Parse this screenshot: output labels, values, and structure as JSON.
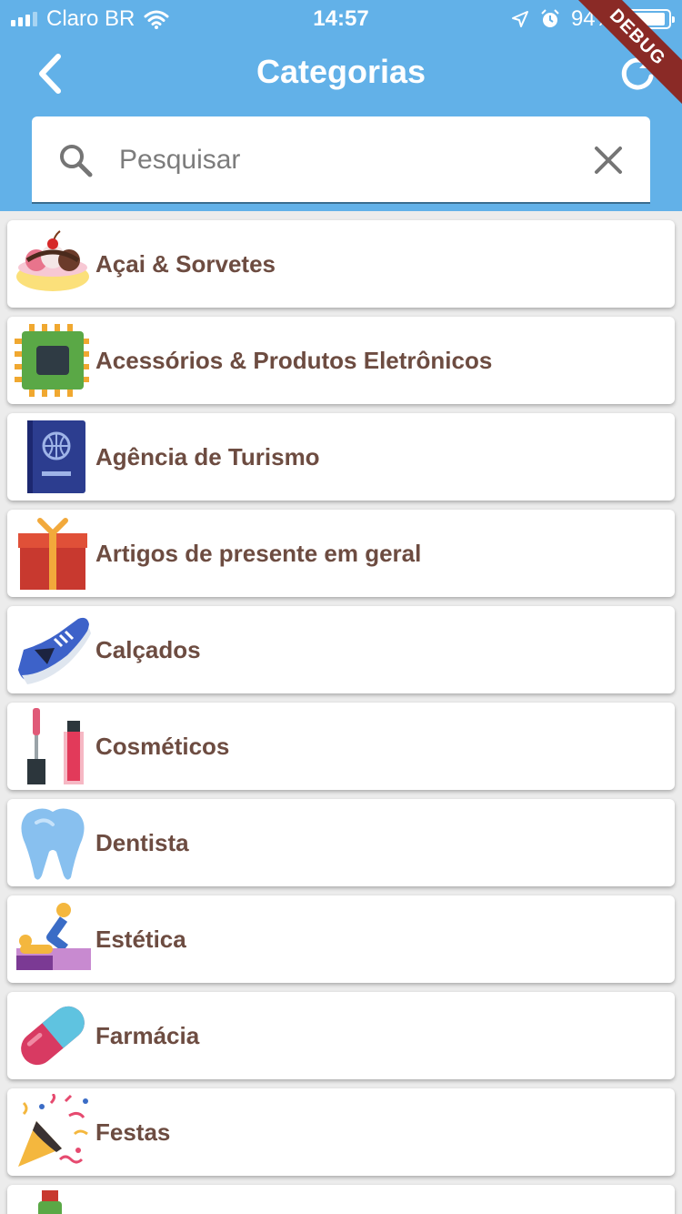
{
  "status_bar": {
    "carrier": "Claro BR",
    "time": "14:57",
    "battery": "94%",
    "battery_level": 0.94,
    "icons": [
      "signal-icon",
      "wifi-icon",
      "location-icon",
      "alarm-icon",
      "battery-icon"
    ]
  },
  "debug_banner": "DEBUG",
  "header": {
    "title": "Categorias",
    "back_icon": "chevron-left-icon",
    "refresh_icon": "refresh-icon",
    "background_color": "#62b1e8"
  },
  "search": {
    "placeholder": "Pesquisar",
    "value": "",
    "search_icon": "search-icon",
    "clear_icon": "close-icon"
  },
  "categories": [
    {
      "label": "Açai & Sorvetes",
      "icon": "ice-cream-icon"
    },
    {
      "label": "Acessórios & Produtos Eletrônicos",
      "icon": "chip-icon"
    },
    {
      "label": "Agência de Turismo",
      "icon": "passport-icon"
    },
    {
      "label": "Artigos de presente em geral",
      "icon": "gift-icon"
    },
    {
      "label": "Calçados",
      "icon": "sneaker-icon"
    },
    {
      "label": "Cosméticos",
      "icon": "lipstick-icon"
    },
    {
      "label": "Dentista",
      "icon": "tooth-icon"
    },
    {
      "label": "Estética",
      "icon": "massage-icon"
    },
    {
      "label": "Farmácia",
      "icon": "pill-icon"
    },
    {
      "label": "Festas",
      "icon": "party-popper-icon"
    },
    {
      "label": "",
      "icon": "bottle-icon"
    }
  ],
  "colors": {
    "label_text": "#6d4c41",
    "list_background": "#ececec"
  }
}
